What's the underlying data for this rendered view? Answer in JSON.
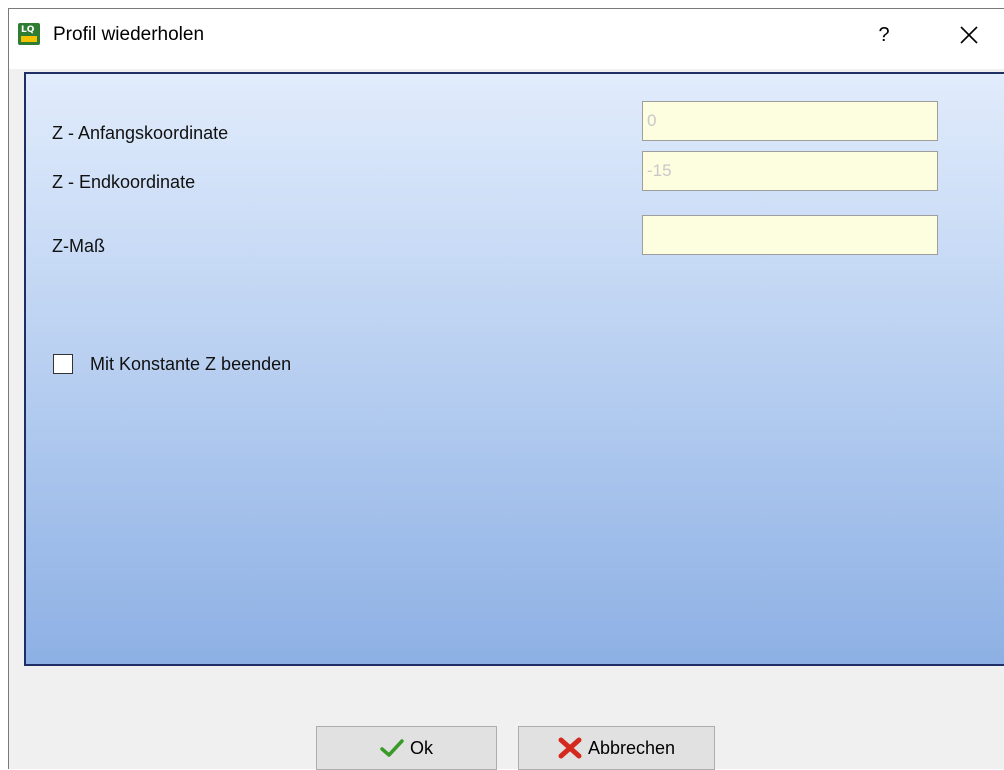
{
  "window": {
    "title": "Profil wiederholen",
    "help_label": "?",
    "icons": {
      "app": "app-logo-icon",
      "close": "close-icon"
    }
  },
  "form": {
    "z_start": {
      "label": "Z - Anfangskoordinate",
      "value": "0"
    },
    "z_end": {
      "label": "Z - Endkoordinate",
      "value": "-15"
    },
    "z_size": {
      "label": "Z-Maß",
      "value": ""
    },
    "finish_constant_z": {
      "label": "Mit Konstante Z beenden",
      "checked": false
    }
  },
  "buttons": {
    "ok": {
      "label": "Ok",
      "icon": "checkmark-icon"
    },
    "cancel": {
      "label": "Abbrechen",
      "icon": "x-mark-icon"
    }
  },
  "colors": {
    "panel_top": "#e1ecfc",
    "panel_bottom": "#8db0e4",
    "input_bg": "#fdfde0",
    "panel_border": "#1f2f66"
  }
}
